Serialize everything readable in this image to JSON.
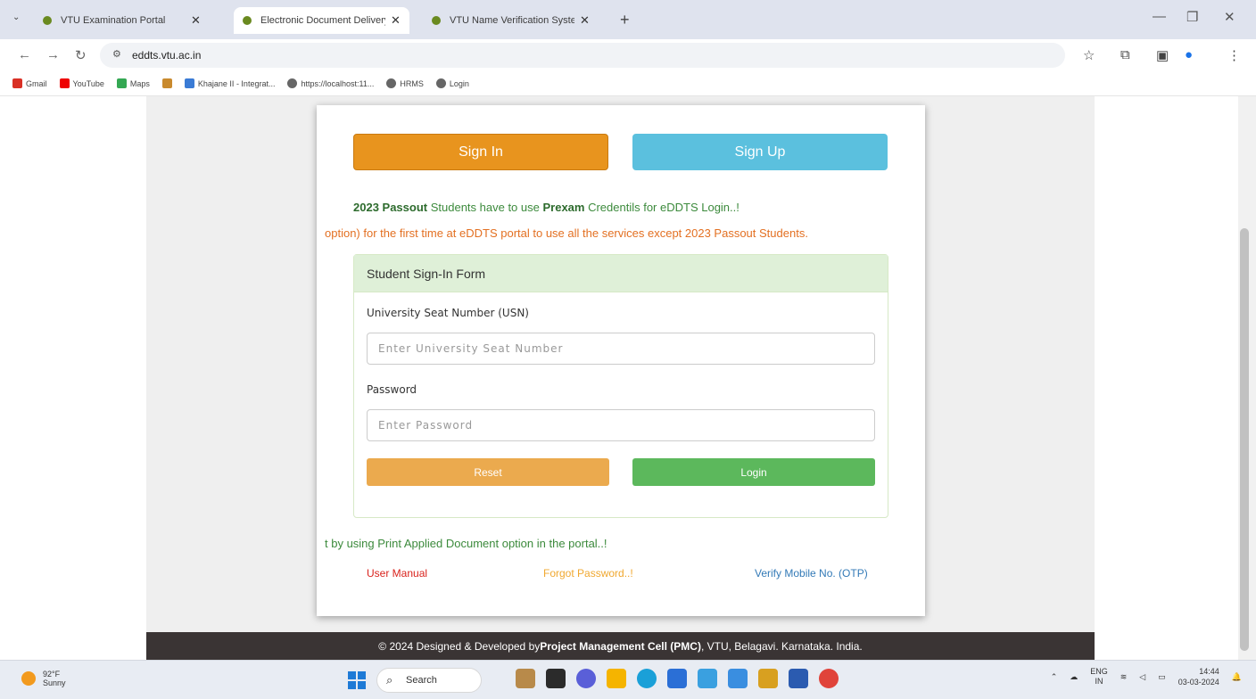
{
  "browser": {
    "tabs": [
      {
        "title": "VTU Examination Portal",
        "active": false
      },
      {
        "title": "Electronic Document Delivery a",
        "active": true
      },
      {
        "title": "VTU Name Verification System",
        "active": false
      }
    ],
    "url": "eddts.vtu.ac.in",
    "bookmarks": [
      "Gmail",
      "YouTube",
      "Maps",
      "Khajane II - Integrat...",
      "https://localhost:11...",
      "HRMS",
      "Login"
    ]
  },
  "auth": {
    "sign_in": "Sign In",
    "sign_up": "Sign Up"
  },
  "notices": {
    "line1_prefix": "2023 Passout",
    "line1_mid": " Students have to use ",
    "line1_bold2": "Prexam",
    "line1_suffix": " Credentils for eDDTS Login..!",
    "line2": "option) for the first time at eDDTS portal to use all the services except 2023 Passout Students.",
    "line3": "t by using Print Applied Document option in the portal..!"
  },
  "form": {
    "heading": "Student Sign-In Form",
    "usn_label": "University Seat Number (USN)",
    "usn_placeholder": "Enter University Seat Number",
    "password_label": "Password",
    "password_placeholder": "Enter Password",
    "reset": "Reset",
    "login": "Login"
  },
  "links": {
    "user_manual": "User Manual",
    "forgot": "Forgot Password..!",
    "verify": "Verify Mobile No. (OTP)"
  },
  "footer": {
    "prefix": "© 2024 Designed & Developed by ",
    "org": "Project Management Cell (PMC)",
    "suffix": ", VTU, Belagavi. Karnataka. India."
  },
  "taskbar": {
    "temp": "92°F",
    "condition": "Sunny",
    "search": "Search",
    "lang": "ENG",
    "region": "IN",
    "time": "14:44",
    "date": "03-03-2024"
  },
  "colors": {
    "sign_in": "#e8941e",
    "sign_up": "#5bc0de",
    "reset": "#ebaa4e",
    "login": "#5cb85c",
    "footer_bg": "#3a3434"
  }
}
